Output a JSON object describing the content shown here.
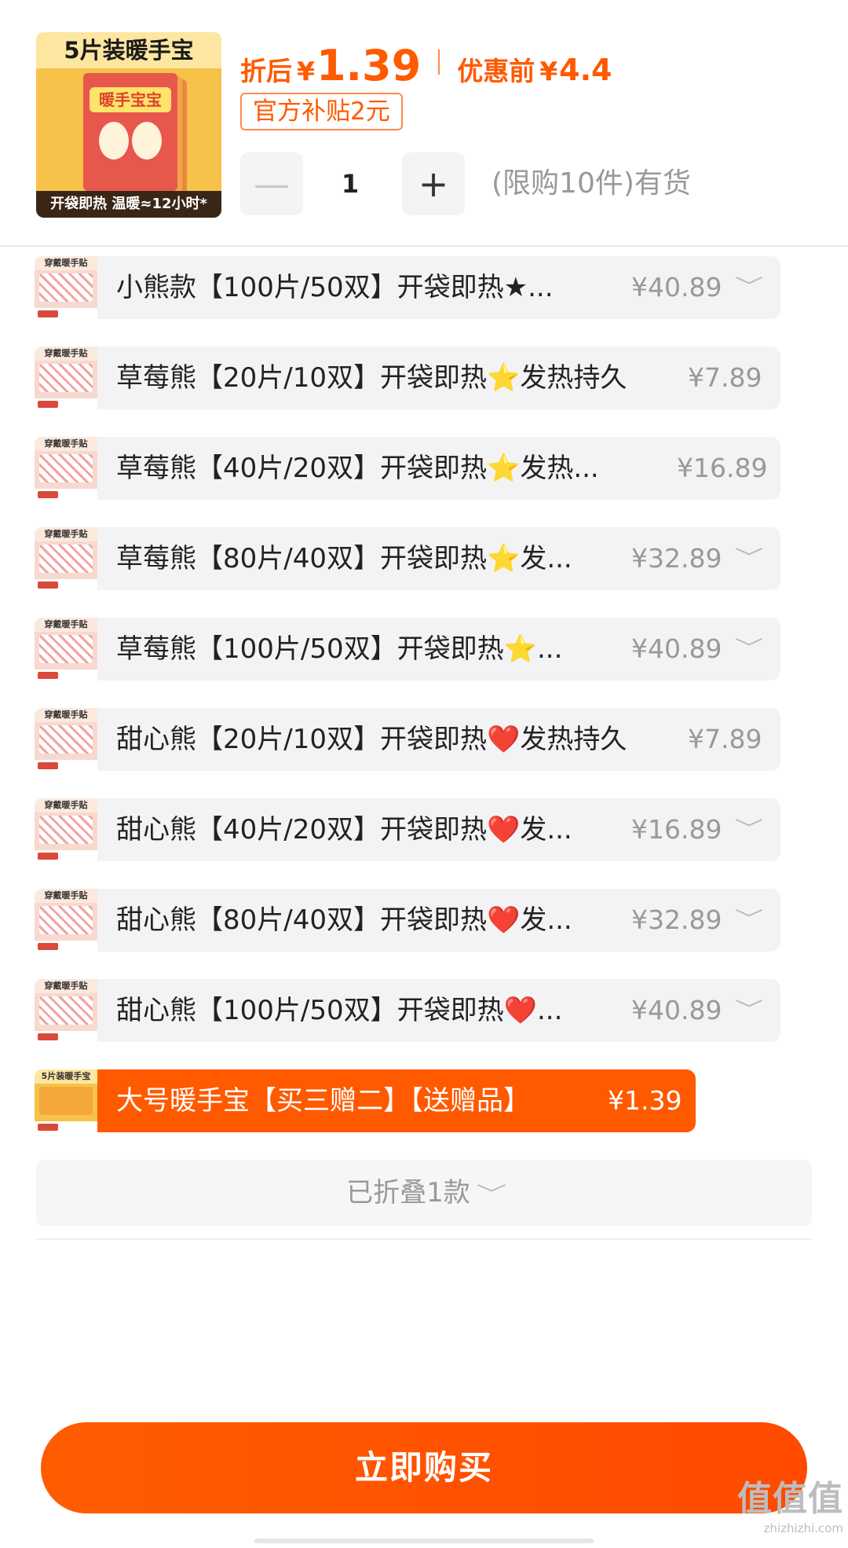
{
  "product": {
    "thumb_top_text": "5片装暖手宝",
    "thumb_pack_text": "暖手宝宝",
    "thumb_bottom_text": "开袋即热 温暖≈12小时*",
    "after_discount_label": "折后",
    "currency": "¥",
    "after_discount_price": "1.39",
    "before_discount_label": "优惠前",
    "before_discount_price": "4.4",
    "subsidy_tag": "官方补贴2元",
    "quantity": "1",
    "minus_symbol": "—",
    "plus_symbol": "+",
    "stock_text": "(限购10件)有货"
  },
  "thumb_caption": "穿戴暖手贴",
  "selected_thumb_caption": "5片装暖手宝",
  "chevron": "﹀",
  "skus": [
    {
      "label": "小熊款【100片/50双】开袋即热★...",
      "price": "¥40.89",
      "has_chevron": true
    },
    {
      "label": "草莓熊【20片/10双】开袋即热⭐发热持久",
      "price": "¥7.89",
      "has_chevron": false
    },
    {
      "label": "草莓熊【40片/20双】开袋即热⭐发热...",
      "price": "¥16.89",
      "has_chevron": false
    },
    {
      "label": "草莓熊【80片/40双】开袋即热⭐发...",
      "price": "¥32.89",
      "has_chevron": true
    },
    {
      "label": "草莓熊【100片/50双】开袋即热⭐...",
      "price": "¥40.89",
      "has_chevron": true
    },
    {
      "label": "甜心熊【20片/10双】开袋即热❤️发热持久",
      "price": "¥7.89",
      "has_chevron": false
    },
    {
      "label": "甜心熊【40片/20双】开袋即热❤️发...",
      "price": "¥16.89",
      "has_chevron": true
    },
    {
      "label": "甜心熊【80片/40双】开袋即热❤️发...",
      "price": "¥32.89",
      "has_chevron": true
    },
    {
      "label": "甜心熊【100片/50双】开袋即热❤️...",
      "price": "¥40.89",
      "has_chevron": true
    },
    {
      "label": "大号暖手宝【买三赠二】【送赠品】",
      "price": "¥1.39",
      "has_chevron": false,
      "selected": true
    }
  ],
  "folded_text": "已折叠1款",
  "buy_button": "立即购买",
  "watermark": {
    "big": "值值值",
    "small": "zhizhizhi.com"
  },
  "colors": {
    "accent": "#ff5a00",
    "muted": "#999999",
    "chip_bg": "#f3f3f5"
  }
}
